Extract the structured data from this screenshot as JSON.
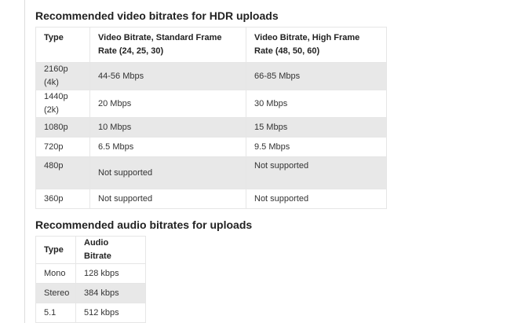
{
  "video": {
    "heading": "Recommended video bitrates for HDR uploads",
    "headers": {
      "type": "Type",
      "standard": "Video Bitrate, Standard Frame Rate (24, 25, 30)",
      "high": "Video Bitrate, High Frame Rate (48, 50, 60)"
    },
    "rows": [
      {
        "type": "2160p (4k)",
        "standard": "44-56 Mbps",
        "high": "66-85 Mbps"
      },
      {
        "type": "1440p (2k)",
        "standard": "20 Mbps",
        "high": "30 Mbps"
      },
      {
        "type": "1080p",
        "standard": "10 Mbps",
        "high": "15 Mbps"
      },
      {
        "type": "720p",
        "standard": "6.5 Mbps",
        "high": "9.5 Mbps"
      },
      {
        "type": "480p",
        "standard": "Not supported",
        "high": "Not supported"
      },
      {
        "type": "360p",
        "standard": "Not supported",
        "high": "Not supported"
      }
    ]
  },
  "audio": {
    "heading": "Recommended audio bitrates for uploads",
    "headers": {
      "type": "Type",
      "bitrate": "Audio Bitrate"
    },
    "rows": [
      {
        "type": "Mono",
        "bitrate": "128 kbps"
      },
      {
        "type": "Stereo",
        "bitrate": "384 kbps"
      },
      {
        "type": "5.1",
        "bitrate": "512 kbps"
      }
    ]
  },
  "colors": {
    "shaded_row": "#e8e8e8",
    "border": "#e6e6e6",
    "heading_text": "#222222",
    "body_text": "#333333"
  }
}
